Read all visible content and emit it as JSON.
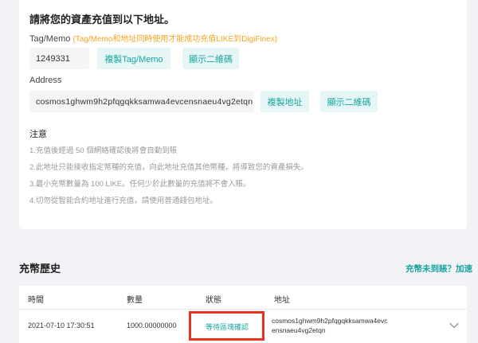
{
  "deposit": {
    "title": "請將您的資產充值到以下地址。",
    "tag_label": "Tag/Memo",
    "tag_note": "(Tag/Memo和地址同時使用才能成功充值LIKE到DigiFinex)",
    "memo_value": "1249331",
    "copy_memo_button": "複製Tag/Memo",
    "qr_memo_button": "顯示二維碼",
    "address_label": "Address",
    "address_value": "cosmos1ghwm9h2pfqgqkksamwa4evcensnaeu4vg2etqn",
    "copy_address_button": "複製地址",
    "qr_address_button": "顯示二維碼",
    "notes_title": "注意",
    "notes": [
      "1.充值後經過 50 個網絡確認後將會自動到賬",
      "2.此地址只能接收指定幣種的充值，向此地址充值其他幣種，將導致您的資產損失。",
      "3.最小充幣數量為 100 LIKE。任何少於此數量的充值將不會入賬。",
      "4.切勿從智能合約地址進行充值，請使用普通錢包地址。"
    ]
  },
  "history": {
    "title": "充幣歷史",
    "not_arrived_link": "充幣未到賬？加速",
    "columns": {
      "time": "時間",
      "amount": "數量",
      "status": "狀態",
      "address": "地址"
    },
    "rows": [
      {
        "time": "2021-07-10 17:30:51",
        "amount": "1000.00000000",
        "status": "等待區塊確認",
        "address": "cosmos1ghwm9h2pfqgqkksamwa4evcensnaeu4vg2etqn"
      }
    ]
  },
  "colors": {
    "accent": "#19a5a0",
    "warning": "#f5a623",
    "highlight_box": "#e8341c"
  }
}
